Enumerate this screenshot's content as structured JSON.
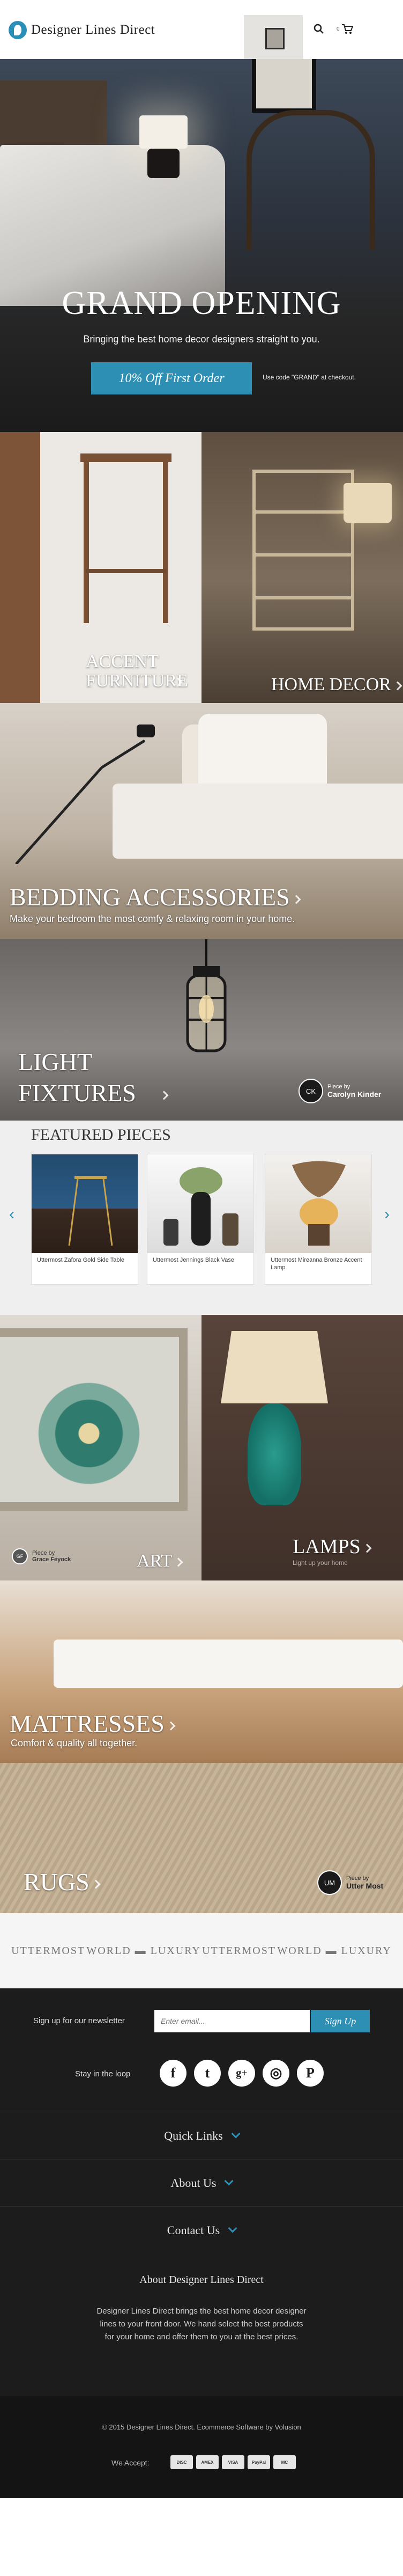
{
  "header": {
    "logo_text": "Designer Lines Direct",
    "cart_count": "0"
  },
  "hero": {
    "title": "GRAND OPENING",
    "subtitle": "Bringing the best home decor designers straight to you.",
    "cta_label": "10% Off First Order",
    "promo_note": "Use code \"GRAND\" at checkout."
  },
  "categories": {
    "accent_furniture": "ACCENT FURNITURE",
    "home_decor": "HOME DECOR",
    "bedding": "BEDDING ACCESSORIES",
    "bedding_sub": "Make your bedroom the most comfy & relaxing room in your home.",
    "lighting": "LIGHT FIXTURES",
    "art": "ART",
    "lamps": "LAMPS",
    "lamps_sub": "Light up your home",
    "mattresses": "MATTRESSES",
    "mattresses_sub": "Comfort & quality all together.",
    "rugs": "RUGS"
  },
  "credits": {
    "piece_by": "Piece by",
    "lighting_initials": "CK",
    "lighting_name": "Carolyn Kinder",
    "art_name": "Grace Feyock",
    "rugs_initials": "UM",
    "rugs_name": "Utter Most"
  },
  "featured": {
    "title": "FEATURED PIECES",
    "items": [
      {
        "name": "Uttermost Zafora Gold Side Table"
      },
      {
        "name": "Uttermost Jennings Black Vase"
      },
      {
        "name": "Uttermost Mireanna Bronze Accent Lamp"
      }
    ]
  },
  "brands": [
    "UTTERMOST",
    "WORLD ▬ LUXURY",
    "UTTERMOST",
    "WORLD ▬ LUXURY"
  ],
  "footer": {
    "newsletter_label": "Sign up for our newsletter",
    "newsletter_placeholder": "Enter email...",
    "newsletter_button": "Sign Up",
    "social_label": "Stay in the loop",
    "social": [
      {
        "icon": "facebook-icon",
        "glyph": "f"
      },
      {
        "icon": "twitter-icon",
        "glyph": "t"
      },
      {
        "icon": "google-plus-icon",
        "glyph": "g+"
      },
      {
        "icon": "instagram-icon",
        "glyph": "◎"
      },
      {
        "icon": "pinterest-icon",
        "glyph": "P"
      }
    ],
    "quick_links": "Quick Links",
    "about_us": "About Us",
    "contact_us": "Contact Us",
    "about_title": "About Designer Lines Direct",
    "about_text": "Designer Lines Direct brings the best home decor designer lines to your front door. We hand select the best products for your home and offer them to you at the best prices.",
    "copyright": "© 2015 Designer Lines Direct. Ecommerce Software by Volusion",
    "accept_label": "We Accept:",
    "payments": [
      "DISC",
      "AMEX",
      "VISA",
      "PayPal",
      "MC"
    ]
  },
  "colors": {
    "accent": "#2e8fb4",
    "footer_bg": "#1c1c1c"
  }
}
